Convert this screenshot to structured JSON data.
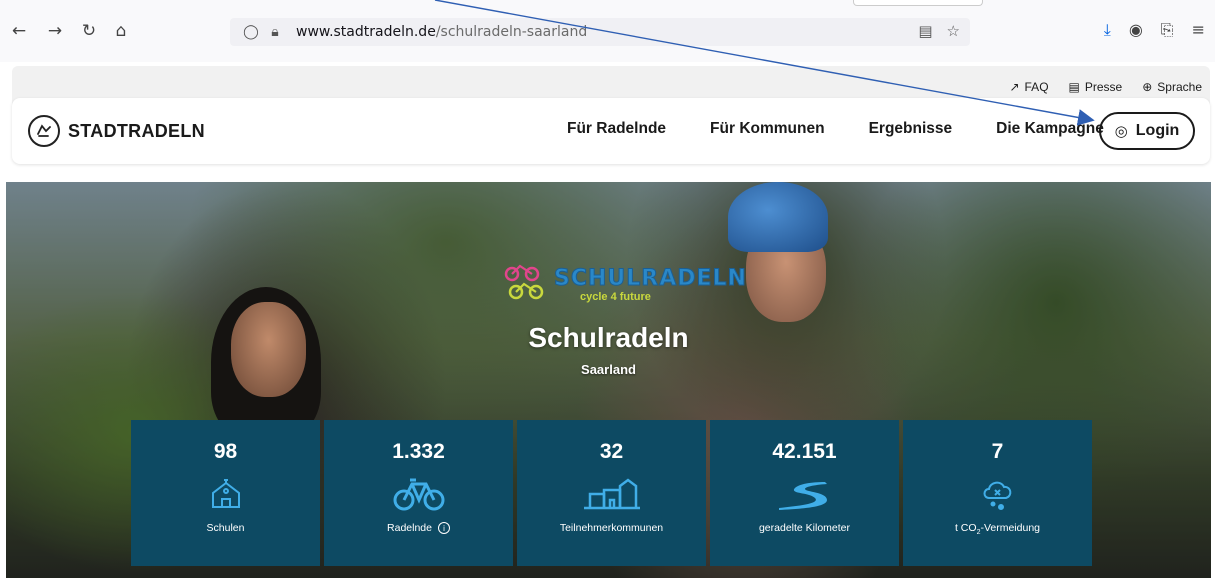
{
  "browser": {
    "url_host": "www.stadtradeln.de",
    "url_path": "/schulradeln-saarland"
  },
  "meta_links": [
    {
      "label": "FAQ",
      "icon": "arrow-up-right-icon"
    },
    {
      "label": "Presse",
      "icon": "newspaper-icon"
    },
    {
      "label": "Sprache",
      "icon": "globe-icon"
    }
  ],
  "nav": {
    "logo_text": "STADTRADELN",
    "items": [
      "Für Radelnde",
      "Für Kommunen",
      "Ergebnisse",
      "Die Kampagne"
    ],
    "login_label": "Login"
  },
  "hero": {
    "brand_title": "SCHULRADELN",
    "brand_sub": "cycle 4 future",
    "title": "Schulradeln",
    "subtitle": "Saarland"
  },
  "stats": [
    {
      "value": "98",
      "label": "Schulen",
      "icon": "school-icon"
    },
    {
      "value": "1.332",
      "label": "Radelnde",
      "icon": "bicycle-icon",
      "info": true
    },
    {
      "value": "32",
      "label": "Teilnehmerkommunen",
      "icon": "buildings-icon"
    },
    {
      "value": "42.151",
      "label": "geradelte Kilometer",
      "icon": "road-icon"
    },
    {
      "value": "7",
      "label_prefix": "t CO",
      "label_sub": "2",
      "label_suffix": "-Vermeidung",
      "icon": "co2-cloud-icon"
    }
  ],
  "colors": {
    "stat_bg": "#0d4a63",
    "stat_icon": "#40aee8",
    "annotation_arrow": "#2f5fb3"
  }
}
